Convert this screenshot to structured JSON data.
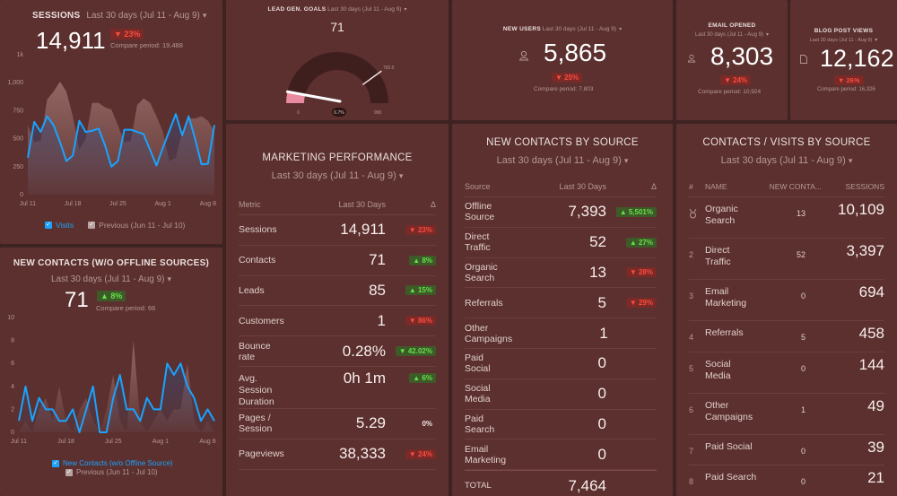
{
  "colors": {
    "panel_bg": "#5b302e",
    "page_bg": "#3f2322",
    "accent_blue": "#1aa3ff",
    "down_red": "#ff4b3f",
    "up_green": "#63e04a",
    "gauge_fill": "#e98aa0"
  },
  "date_range": "Last 30 days (Jul 11 - Aug 9)",
  "sessions": {
    "title": "SESSIONS",
    "value": "14,911",
    "delta": "▼ 23%",
    "delta_dir": "down",
    "compare": "Compare period: 19,488",
    "legend_current": "Visits",
    "legend_previous": "Previous (Jun 11 - Jul 10)"
  },
  "new_contacts": {
    "title": "NEW CONTACTS (W/O OFFLINE SOURCES)",
    "value": "71",
    "delta": "▲ 8%",
    "delta_dir": "up",
    "compare": "Compare period: 66",
    "legend_current": "New Contacts (w/o Offline Source)",
    "legend_previous": "Previous (Jun 11 - Jul 10)"
  },
  "lead_gen": {
    "title": "LEAD GEN. GOALS",
    "value": "71",
    "gauge_min": "0",
    "gauge_max": "990",
    "gauge_target": "792.0",
    "gauge_pct_label": "6.7%",
    "gauge_fraction": 0.072,
    "target_fraction": 0.8
  },
  "new_users": {
    "title": "NEW USERS",
    "icon": "user-icon",
    "value": "5,865",
    "delta": "▼ 25%",
    "compare": "Compare period: 7,803"
  },
  "email_opened": {
    "title": "EMAIL OPENED",
    "icon": "user-icon",
    "value": "8,303",
    "delta": "▼ 24%",
    "compare": "Compare period: 10,924"
  },
  "blog_views": {
    "title": "BLOG POST VIEWS",
    "icon": "document-icon",
    "value": "12,162",
    "delta": "▼ 26%",
    "compare": "Compare period: 16,326"
  },
  "marketing": {
    "title": "MARKETING PERFORMANCE",
    "col_metric": "Metric",
    "col_value": "Last 30 Days",
    "col_delta": "Δ",
    "rows": [
      {
        "metric": "Sessions",
        "value": "14,911",
        "delta": "▼ 23%",
        "dir": "down"
      },
      {
        "metric": "Contacts",
        "value": "71",
        "delta": "▲ 8%",
        "dir": "up"
      },
      {
        "metric": "Leads",
        "value": "85",
        "delta": "▲ 15%",
        "dir": "up"
      },
      {
        "metric": "Customers",
        "value": "1",
        "delta": "▼ 86%",
        "dir": "down"
      },
      {
        "metric": "Bounce rate",
        "value": "0.28%",
        "delta": "▼ 42.02%",
        "dir": "up"
      },
      {
        "metric": "Avg. Session Duration",
        "value": "0h 1m",
        "delta": "▲ 6%",
        "dir": "up"
      },
      {
        "metric": "Pages / Session",
        "value": "5.29",
        "delta": "0%",
        "dir": "neutral"
      },
      {
        "metric": "Pageviews",
        "value": "38,333",
        "delta": "▼ 24%",
        "dir": "down"
      }
    ]
  },
  "contacts_by_source": {
    "title": "NEW CONTACTS BY SOURCE",
    "col_source": "Source",
    "col_value": "Last 30 Days",
    "col_delta": "Δ",
    "rows": [
      {
        "source": "Offline Source",
        "value": "7,393",
        "delta": "▲ 5,501%",
        "dir": "up"
      },
      {
        "source": "Direct Traffic",
        "value": "52",
        "delta": "▲ 27%",
        "dir": "up"
      },
      {
        "source": "Organic Search",
        "value": "13",
        "delta": "▼ 28%",
        "dir": "down"
      },
      {
        "source": "Referrals",
        "value": "5",
        "delta": "▼ 29%",
        "dir": "down"
      },
      {
        "source": "Other Campaigns",
        "value": "1",
        "delta": "",
        "dir": "none"
      },
      {
        "source": "Paid Social",
        "value": "0",
        "delta": "",
        "dir": "none"
      },
      {
        "source": "Social Media",
        "value": "0",
        "delta": "",
        "dir": "none"
      },
      {
        "source": "Paid Search",
        "value": "0",
        "delta": "",
        "dir": "none"
      },
      {
        "source": "Email Marketing",
        "value": "0",
        "delta": "",
        "dir": "none"
      }
    ],
    "total_label": "TOTAL",
    "total_value": "7,464"
  },
  "visits_by_source": {
    "title": "CONTACTS / VISITS BY SOURCE",
    "col_num": "#",
    "col_name": "NAME",
    "col_contacts": "NEW CONTA...",
    "col_sessions": "SESSIONS",
    "rows": [
      {
        "rank": "medal",
        "name": "Organic Search",
        "contacts": "13",
        "sessions": "10,109"
      },
      {
        "rank": "2",
        "name": "Direct Traffic",
        "contacts": "52",
        "sessions": "3,397"
      },
      {
        "rank": "3",
        "name": "Email Marketing",
        "contacts": "0",
        "sessions": "694"
      },
      {
        "rank": "4",
        "name": "Referrals",
        "contacts": "5",
        "sessions": "458"
      },
      {
        "rank": "5",
        "name": "Social Media",
        "contacts": "0",
        "sessions": "144"
      },
      {
        "rank": "6",
        "name": "Other Campaigns",
        "contacts": "1",
        "sessions": "49"
      },
      {
        "rank": "7",
        "name": "Paid Social",
        "contacts": "0",
        "sessions": "39"
      },
      {
        "rank": "8",
        "name": "Paid Search",
        "contacts": "0",
        "sessions": "21"
      }
    ]
  },
  "chart_data": [
    {
      "type": "area",
      "title": "SESSIONS",
      "x_ticks": [
        "Jul 11",
        "Jul 18",
        "Jul 25",
        "Aug 1",
        "Aug 8"
      ],
      "y_ticks": [
        "0",
        "250",
        "500",
        "750",
        "1,000",
        "1k"
      ],
      "ylim": [
        0,
        1250
      ],
      "series": [
        {
          "name": "Visits",
          "color": "#1aa3ff",
          "values": [
            330,
            650,
            560,
            700,
            620,
            470,
            300,
            350,
            660,
            560,
            570,
            590,
            440,
            250,
            300,
            580,
            580,
            560,
            540,
            400,
            260,
            420,
            570,
            720,
            530,
            700,
            500,
            270,
            275,
            620
          ]
        },
        {
          "name": "Previous (Jun 11 - Jul 10)",
          "color": "#b8a5a2",
          "values": [
            620,
            470,
            480,
            850,
            920,
            1010,
            920,
            700,
            400,
            500,
            820,
            820,
            780,
            760,
            620,
            470,
            480,
            800,
            860,
            820,
            700,
            560,
            300,
            330,
            560,
            680,
            680,
            700,
            660,
            560
          ]
        }
      ]
    },
    {
      "type": "area",
      "title": "NEW CONTACTS (W/O OFFLINE SOURCES)",
      "x_ticks": [
        "Jul 11",
        "Jul 18",
        "Jul 25",
        "Aug 1",
        "Aug 8"
      ],
      "y_ticks": [
        "0",
        "2",
        "4",
        "6",
        "8",
        "10"
      ],
      "ylim": [
        0,
        10
      ],
      "series": [
        {
          "name": "New Contacts (w/o Offline Source)",
          "color": "#1aa3ff",
          "values": [
            1,
            4,
            1,
            3,
            2,
            2,
            1,
            1,
            2,
            0,
            2,
            4,
            0,
            0,
            3,
            5,
            2,
            2,
            1,
            3,
            2,
            2,
            6,
            5,
            6,
            4,
            3,
            1,
            2,
            1
          ]
        },
        {
          "name": "Previous (Jun 11 - Jul 10)",
          "color": "#b8a5a2",
          "values": [
            0,
            1,
            0,
            2,
            3,
            1,
            4,
            1,
            0,
            2,
            3,
            1,
            0,
            2,
            5,
            1,
            0,
            8,
            1,
            0,
            1,
            2,
            1,
            2,
            2,
            6,
            1,
            0,
            1,
            0
          ]
        }
      ]
    }
  ]
}
